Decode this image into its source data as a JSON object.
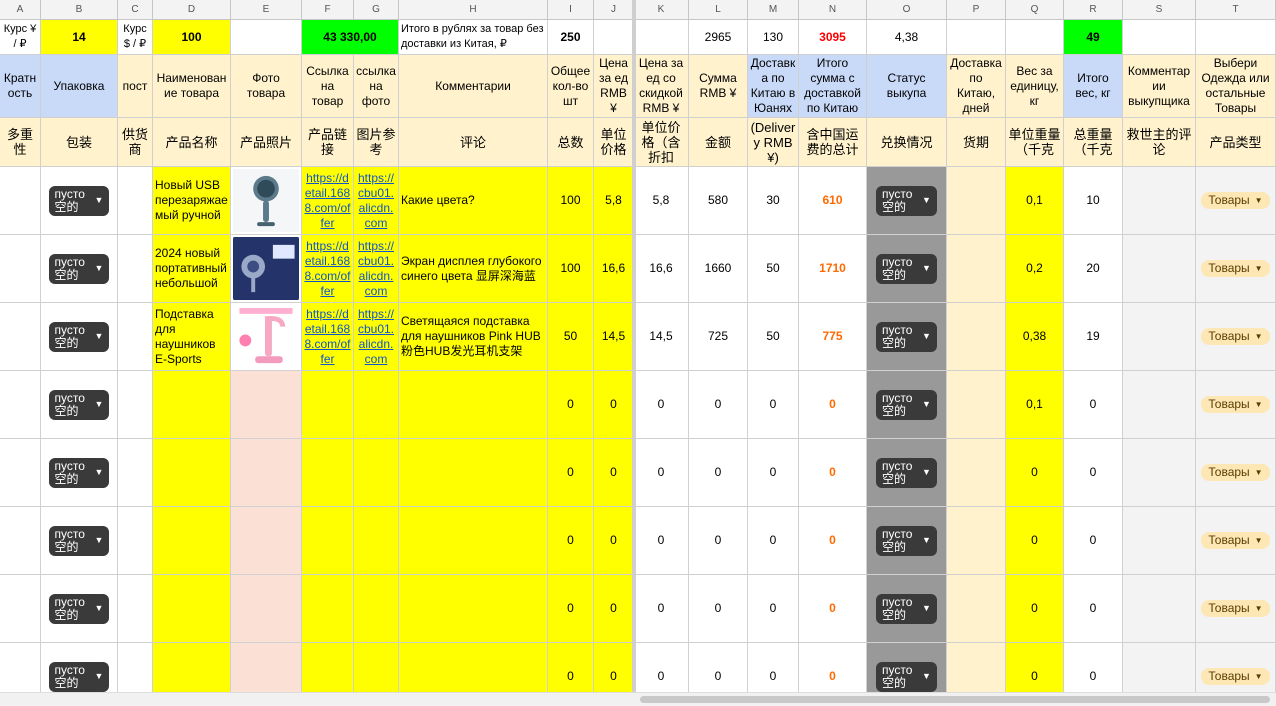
{
  "columns": [
    "A",
    "B",
    "C",
    "D",
    "E",
    "F",
    "G",
    "H",
    "I",
    "J",
    "K",
    "L",
    "M",
    "N",
    "O",
    "P",
    "Q",
    "R",
    "S",
    "T"
  ],
  "summary": {
    "rate_cny_label": "Курс ¥ / ₽",
    "rate_cny_value": "14",
    "rate_usd_label": "Курс $ / ₽",
    "rate_usd_value": "100",
    "total_rub": "43 330,00",
    "total_rub_label": "Итого в рублях за товар без доставки из Китая, ₽",
    "total_qty": "250",
    "sum_rmb": "2965",
    "sum_delivery": "130",
    "sum_total_cn": "3095",
    "avg_value": "4,38",
    "total_weight": "49"
  },
  "headers_ru": [
    "Кратность",
    "Упаковка",
    "пост",
    "Наименование товара",
    "Фото товара",
    "Ссылка на товар",
    "ссылка на фото",
    "Комментарии",
    "Общее кол-во шт",
    "Цена за ед RMB ¥",
    "Цена за ед со скидкой RMB ¥",
    "Сумма RMB ¥",
    "Доставка по Китаю в Юанях",
    "Итого сумма с доставкой по Китаю",
    "Статус выкупа",
    "Доставка по Китаю, дней",
    "Вес за единицу, кг",
    "Итого вес, кг",
    "Комментарии выкупщика",
    "Выбери Одежда или остальные Товары"
  ],
  "headers_cn": [
    "多重性",
    "包装",
    "供货商",
    "产品名称",
    "产品照片",
    "产品链接",
    "图片参考",
    "评论",
    "总数",
    "单位价格",
    "单位价格（含折扣",
    "金额",
    "(Delivery RMB ¥)",
    "含中国运费的总计",
    "兑换情况",
    "货期",
    "单位重量（千克",
    "总重量（千克",
    "救世主的评论",
    "产品类型"
  ],
  "status_label": "пусто 空的",
  "type_label": "Товары",
  "rows": [
    {
      "name": "Новый USB перезаряжаемый ручной",
      "link": "https://detail.1688.com/offer",
      "photo_link": "https://cbu01.alicdn.com",
      "comment": "Какие цвета?",
      "qty": "100",
      "price": "5,8",
      "disc_price": "5,8",
      "sum": "580",
      "delivery": "30",
      "total": "610",
      "unit_weight": "0,1",
      "total_weight": "10"
    },
    {
      "name": "2024 новый портативный небольшой",
      "link": "https://detail.1688.com/offer",
      "photo_link": "https://cbu01.alicdn.com",
      "comment": "Экран дисплея глубокого синего цвета 显屏深海蓝",
      "qty": "100",
      "price": "16,6",
      "disc_price": "16,6",
      "sum": "1660",
      "delivery": "50",
      "total": "1710",
      "unit_weight": "0,2",
      "total_weight": "20"
    },
    {
      "name": "Подставка для наушников E-Sports",
      "link": "https://detail.1688.com/offer",
      "photo_link": "https://cbu01.alicdn.com",
      "comment": "Светящаяся подставка для наушников Pink HUB 粉色HUB发光耳机支架",
      "qty": "50",
      "price": "14,5",
      "disc_price": "14,5",
      "sum": "725",
      "delivery": "50",
      "total": "775",
      "unit_weight": "0,38",
      "total_weight": "19"
    },
    {
      "name": "",
      "link": "",
      "photo_link": "",
      "comment": "",
      "qty": "0",
      "price": "0",
      "disc_price": "0",
      "sum": "0",
      "delivery": "0",
      "total": "0",
      "unit_weight": "0,1",
      "total_weight": "0"
    },
    {
      "name": "",
      "link": "",
      "photo_link": "",
      "comment": "",
      "qty": "0",
      "price": "0",
      "disc_price": "0",
      "sum": "0",
      "delivery": "0",
      "total": "0",
      "unit_weight": "0",
      "total_weight": "0"
    },
    {
      "name": "",
      "link": "",
      "photo_link": "",
      "comment": "",
      "qty": "0",
      "price": "0",
      "disc_price": "0",
      "sum": "0",
      "delivery": "0",
      "total": "0",
      "unit_weight": "0",
      "total_weight": "0"
    },
    {
      "name": "",
      "link": "",
      "photo_link": "",
      "comment": "",
      "qty": "0",
      "price": "0",
      "disc_price": "0",
      "sum": "0",
      "delivery": "0",
      "total": "0",
      "unit_weight": "0",
      "total_weight": "0"
    },
    {
      "name": "",
      "link": "",
      "photo_link": "",
      "comment": "",
      "qty": "0",
      "price": "0",
      "disc_price": "0",
      "sum": "0",
      "delivery": "0",
      "total": "0",
      "unit_weight": "0",
      "total_weight": "0"
    }
  ],
  "colors": {
    "yellow": "#ffff00",
    "light_yellow": "#fff2cc",
    "blue_header": "#c9daf8",
    "green": "#00ff00",
    "gray_status": "#999999",
    "pink_photo": "#fbe0d6",
    "light_gray": "#f3f3f3"
  },
  "icons": {
    "dropdown": "dropdown-arrow-icon"
  }
}
